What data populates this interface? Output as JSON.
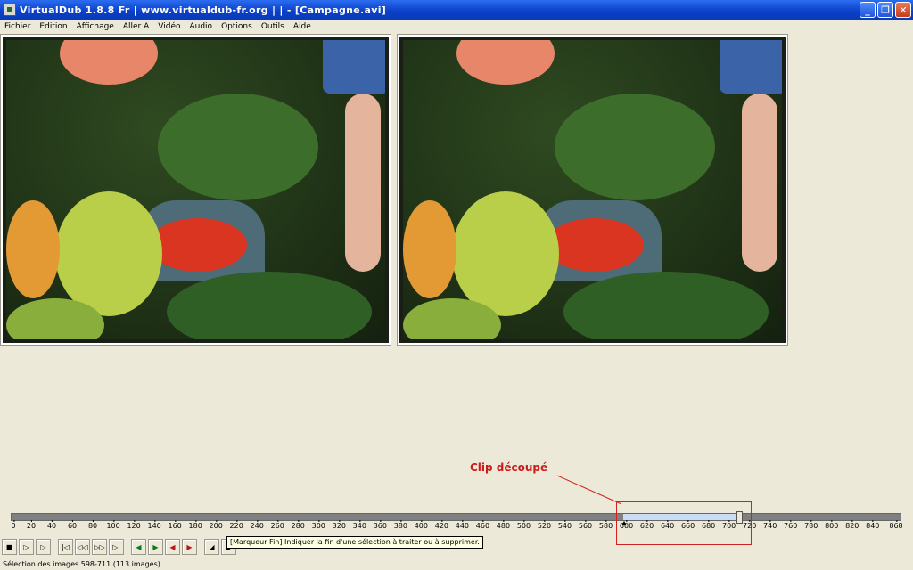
{
  "window": {
    "title": "VirtualDub 1.8.8 Fr | www.virtualdub-fr.org | |   - [Campagne.avi]",
    "minimize": "_",
    "maximize": "❐",
    "close": "✕"
  },
  "menu": [
    "Fichier",
    "Edition",
    "Affichage",
    "Aller A",
    "Vidéo",
    "Audio",
    "Options",
    "Outils",
    "Aide"
  ],
  "annotation": "Clip découpé",
  "timeline": {
    "ticks": [
      "0",
      "20",
      "40",
      "60",
      "80",
      "100",
      "120",
      "140",
      "160",
      "180",
      "200",
      "220",
      "240",
      "260",
      "280",
      "300",
      "320",
      "340",
      "360",
      "380",
      "400",
      "420",
      "440",
      "460",
      "480",
      "500",
      "520",
      "540",
      "560",
      "580",
      "600",
      "620",
      "640",
      "660",
      "680",
      "700",
      "720",
      "740",
      "760",
      "780",
      "800",
      "820",
      "840",
      "868"
    ],
    "total": 868,
    "selection_start": 598,
    "selection_end": 711
  },
  "tooltip": "[Marqueur Fin] Indiquer la fin d'une sélection à traiter ou à supprimer.",
  "status": "Sélection des images 598-711 (113 images)",
  "colors": {
    "title_bar": "#0a3fc7",
    "annotation": "#cc1a1a",
    "selection": "#c8dcf5"
  }
}
